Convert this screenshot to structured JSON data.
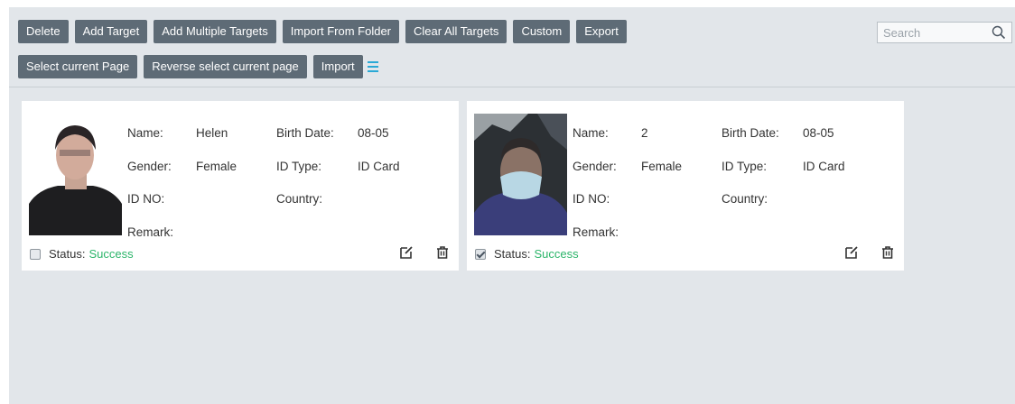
{
  "toolbar": {
    "row1": [
      "Delete",
      "Add Target",
      "Add Multiple Targets",
      "Import From Folder",
      "Clear All Targets",
      "Custom",
      "Export"
    ],
    "row2": [
      "Select current Page",
      "Reverse select current page",
      "Import"
    ],
    "list_icon": "list-icon"
  },
  "search": {
    "placeholder": "Search",
    "value": "",
    "icon": "search-icon"
  },
  "labels": {
    "name": "Name:",
    "gender": "Gender:",
    "id_no": "ID NO:",
    "remark": "Remark:",
    "birth_date": "Birth Date:",
    "id_type": "ID Type:",
    "country": "Country:",
    "status": "Status:"
  },
  "cards": [
    {
      "name": "Helen",
      "gender": "Female",
      "birth_date": "08-05",
      "id_type": "ID Card",
      "id_no": "",
      "country": "",
      "remark": "",
      "status": "Success",
      "checked": false,
      "edit_icon": "edit-icon",
      "delete_icon": "trash-icon"
    },
    {
      "name": "2",
      "gender": "Female",
      "birth_date": "08-05",
      "id_type": "ID Card",
      "id_no": "",
      "country": "",
      "remark": "",
      "status": "Success",
      "checked": true,
      "edit_icon": "edit-icon",
      "delete_icon": "trash-icon"
    }
  ],
  "colors": {
    "button_bg": "#5e6b76",
    "status_success": "#2cb56a",
    "list_icon": "#2aa9d6",
    "panel_bg": "#e2e6ea"
  }
}
